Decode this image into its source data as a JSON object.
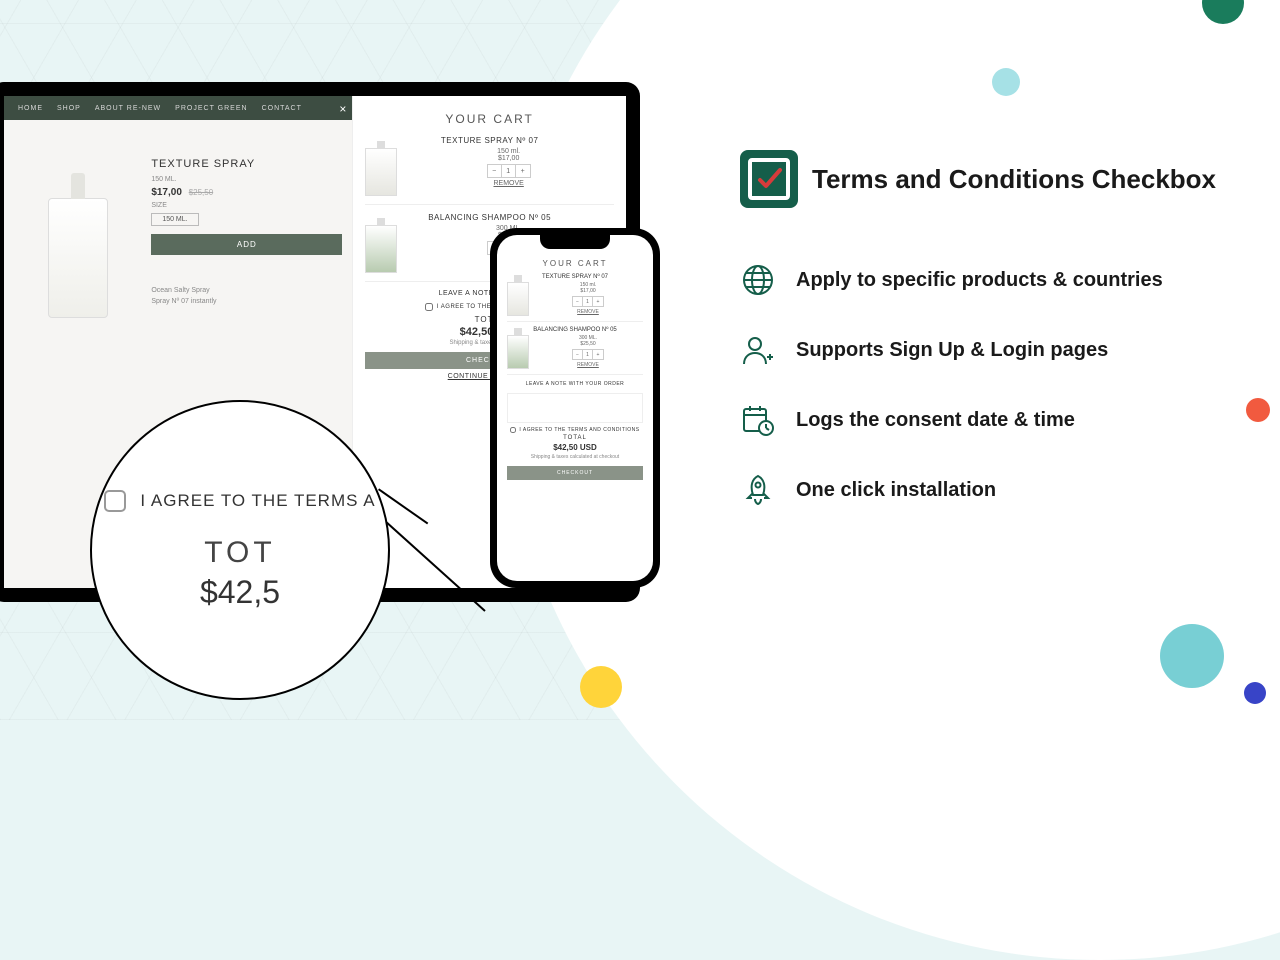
{
  "nav": [
    "HOME",
    "SHOP",
    "ABOUT RE-NEW",
    "PROJECT GREEN",
    "CONTACT"
  ],
  "product": {
    "name": "TEXTURE SPRAY",
    "size_label": "150 ML.",
    "price": "$17,00",
    "compare": "$25,50",
    "size_title": "SIZE",
    "size_option": "150 ML.",
    "add_label": "ADD",
    "desc_title": "Ocean Salty Spray",
    "desc_line": "Spray Nº 07 instantly"
  },
  "cart": {
    "title": "YOUR CART",
    "items": [
      {
        "name": "TEXTURE SPRAY Nº 07",
        "size": "150 ml.",
        "price": "$17,00",
        "qty": "1",
        "thumb": "plain"
      },
      {
        "name": "BALANCING SHAMPOO Nº 05",
        "size": "300 ML.",
        "price": "$25,50",
        "qty": "1",
        "thumb": "green"
      }
    ],
    "remove": "REMOVE",
    "minus": "−",
    "plus": "+",
    "note": "LEAVE A NOTE WITH YOUR",
    "note_full": "LEAVE A NOTE WITH YOUR ORDER",
    "agree": "I AGREE TO THE TERMS AND CONDITIONS",
    "agree_short": "I AGREE TO THE TERMS AND COND",
    "total_label": "TOTAL",
    "total_value": "$42,50 USD",
    "shipping": "Shipping & taxes calculated at checkout",
    "shipping_short": "Shipping & taxes calculated at",
    "checkout": "CHECKOUT",
    "continue": "CONTINUE SHOPPING"
  },
  "magnifier": {
    "agree": "I AGREE TO THE TERMS A",
    "total": "TOT",
    "price": "$42,5"
  },
  "marketing": {
    "title": "Terms and Conditions Checkbox",
    "features": [
      "Apply to specific products & countries",
      "Supports Sign Up & Login pages",
      "Logs the consent date & time",
      "One click installation"
    ]
  },
  "colors": {
    "brand_green": "#155e4a",
    "check_red": "#d63b3b"
  }
}
